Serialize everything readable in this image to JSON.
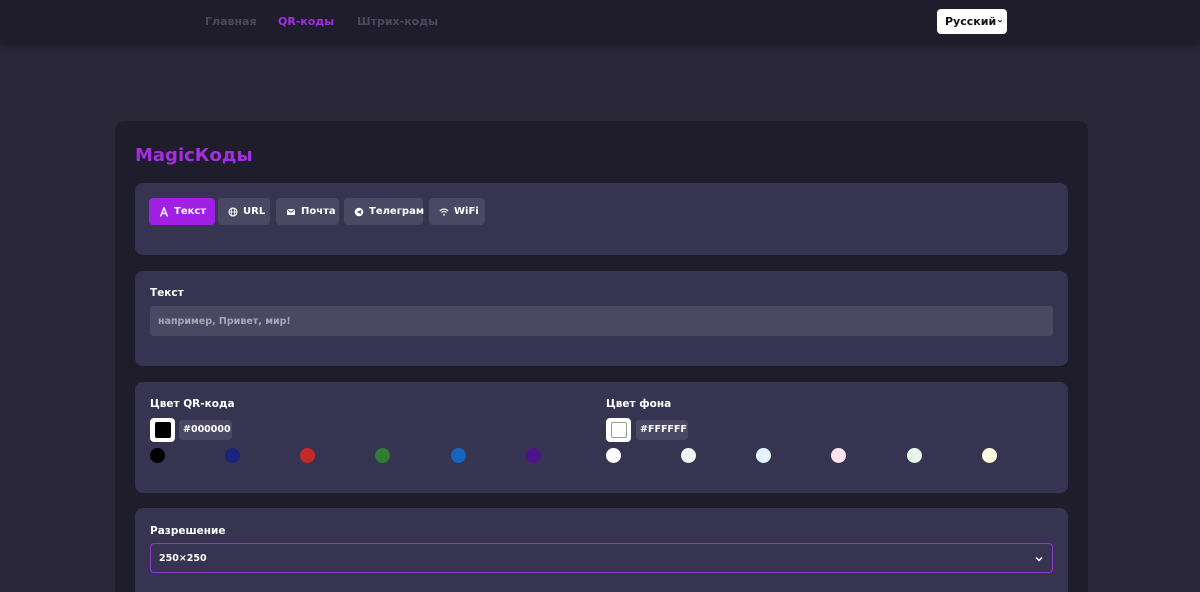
{
  "nav": {
    "links": [
      {
        "label": "Главная"
      },
      {
        "label": "QR-коды"
      },
      {
        "label": "Штрих-коды"
      }
    ],
    "language": "Русский"
  },
  "brand": "MagicКоды",
  "tabs": [
    {
      "label": "Текст",
      "icon": "text-icon"
    },
    {
      "label": "URL",
      "icon": "globe-icon"
    },
    {
      "label": "Почта",
      "icon": "mail-icon"
    },
    {
      "label": "Телеграм",
      "icon": "telegram-icon"
    },
    {
      "label": "WiFi",
      "icon": "wifi-icon"
    }
  ],
  "active_tab": "Текст",
  "text_field": {
    "label": "Текст",
    "placeholder": "например, Привет, мир!",
    "value": ""
  },
  "qr_color": {
    "label": "Цвет QR-кода",
    "value": "#000000",
    "presets": [
      "#000000",
      "#1a237e",
      "#c62828",
      "#2e7d32",
      "#1565c0",
      "#4a148c"
    ]
  },
  "bg_color": {
    "label": "Цвет фона",
    "value": "#FFFFFF",
    "presets": [
      "#ffffff",
      "#f5f5f5",
      "#e3f2fd",
      "#fce4ec",
      "#e8f5e9",
      "#fff8e1"
    ]
  },
  "resolution": {
    "label": "Разрешение",
    "value": "250×250"
  }
}
